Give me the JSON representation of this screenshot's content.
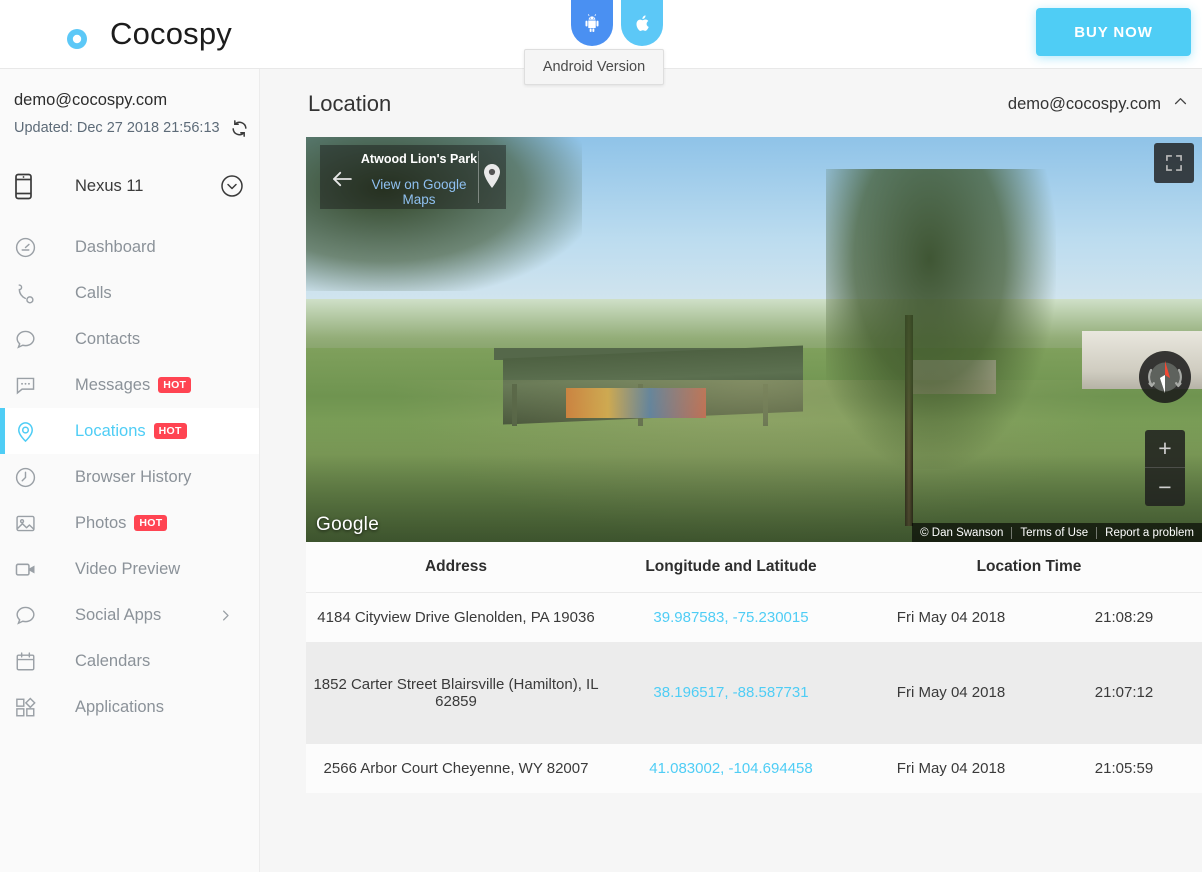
{
  "topbar": {
    "brand_name": "Cocospy",
    "buy_now_label": "BUY NOW",
    "tabs": [
      {
        "id": "android",
        "icon": "android-icon",
        "color": "#4a90f2"
      },
      {
        "id": "apple",
        "icon": "apple-icon",
        "color": "#5cc8f7"
      }
    ],
    "tooltip": "Android Version"
  },
  "sidebar": {
    "account_email": "demo@cocospy.com",
    "updated_label": "Updated: Dec 27 2018 21:56:13",
    "refresh_icon": "refresh-icon",
    "device": {
      "icon": "phone-icon",
      "name": "Nexus 11",
      "caret_icon": "chevron-down-circle-icon"
    },
    "items": [
      {
        "label": "Dashboard",
        "icon": "dashboard-icon",
        "badge": "",
        "active": false,
        "chevron": false
      },
      {
        "label": "Calls",
        "icon": "phone-call-icon",
        "badge": "",
        "active": false,
        "chevron": false
      },
      {
        "label": "Contacts",
        "icon": "contacts-icon",
        "badge": "",
        "active": false,
        "chevron": false
      },
      {
        "label": "Messages",
        "icon": "message-bubble-icon",
        "badge": "HOT",
        "active": false,
        "chevron": false
      },
      {
        "label": "Locations",
        "icon": "location-pin-icon",
        "badge": "HOT",
        "active": true,
        "chevron": false
      },
      {
        "label": "Browser History",
        "icon": "clock-icon",
        "badge": "",
        "active": false,
        "chevron": false
      },
      {
        "label": "Photos",
        "icon": "photo-icon",
        "badge": "HOT",
        "active": false,
        "chevron": false
      },
      {
        "label": "Video Preview",
        "icon": "video-camera-icon",
        "badge": "",
        "active": false,
        "chevron": false
      },
      {
        "label": "Social Apps",
        "icon": "chat-bubble-icon",
        "badge": "",
        "active": false,
        "chevron": true
      },
      {
        "label": "Calendars",
        "icon": "calendar-icon",
        "badge": "",
        "active": false,
        "chevron": false
      },
      {
        "label": "Applications",
        "icon": "apps-grid-icon",
        "badge": "",
        "active": false,
        "chevron": false
      }
    ]
  },
  "main": {
    "page_title": "Location",
    "account_menu_label": "demo@cocospy.com",
    "account_menu_icon": "chevron-up-icon"
  },
  "streetview": {
    "place_name": "Atwood Lion's Park",
    "map_link_label": "View on Google Maps",
    "back_icon": "arrow-left-icon",
    "pin_icon": "map-pin-icon",
    "fullscreen_icon": "fullscreen-icon",
    "compass_icon": "compass-icon",
    "zoom_in_label": "+",
    "zoom_out_label": "−",
    "google_logo": "Google",
    "attribution": [
      "© Dan Swanson",
      "Terms of Use",
      "Report a problem"
    ]
  },
  "table": {
    "columns": [
      "Address",
      "Longitude and Latitude",
      "Location Time"
    ],
    "rows": [
      {
        "address": "4184 Cityview Drive Glenolden, PA 19036",
        "coords": "39.987583, -75.230015",
        "date": "Fri May 04 2018",
        "time": "21:08:29"
      },
      {
        "address": "1852 Carter Street Blairsville (Hamilton), IL 62859",
        "coords": "38.196517, -88.587731",
        "date": "Fri May 04 2018",
        "time": "21:07:12"
      },
      {
        "address": "2566 Arbor Court Cheyenne, WY 82007",
        "coords": "41.083002, -104.694458",
        "date": "Fri May 04 2018",
        "time": "21:05:59"
      }
    ]
  },
  "colors": {
    "accent": "#4fcdf5",
    "brand_blue": "#2f80f0",
    "hot_red": "#ff4452",
    "android_tab": "#4a90f2",
    "apple_tab": "#5cc8f7"
  }
}
